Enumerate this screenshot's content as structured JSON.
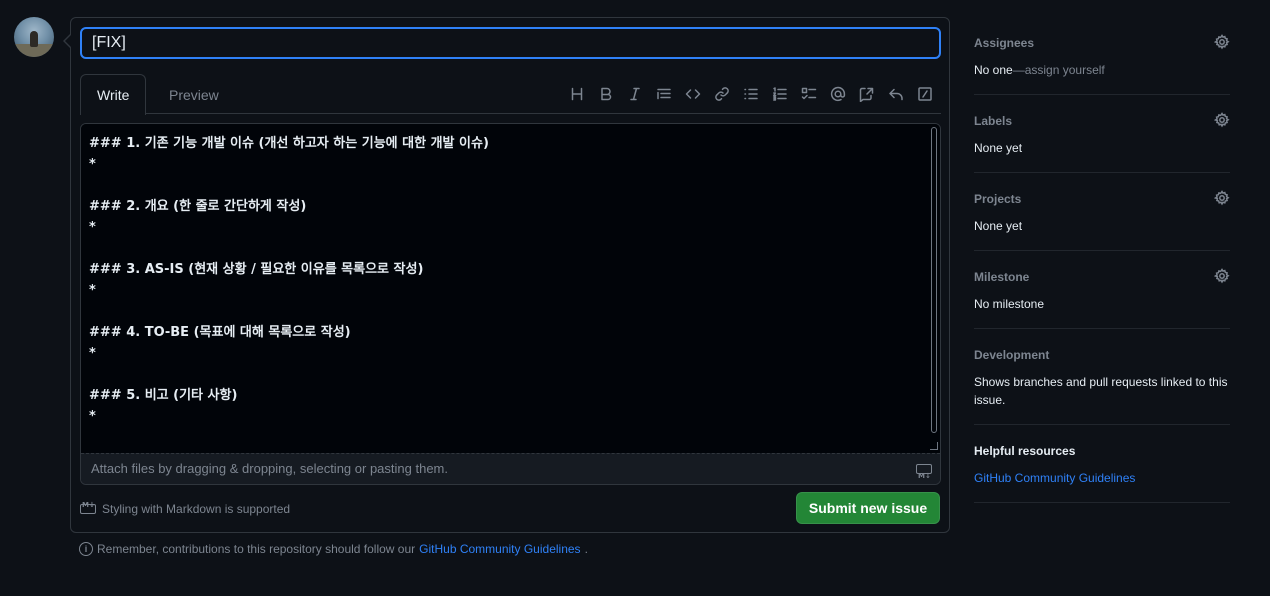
{
  "title_input": {
    "value": "[FIX]"
  },
  "tabs": {
    "write": "Write",
    "preview": "Preview"
  },
  "toolbar": [
    "heading-icon",
    "bold-icon",
    "italic-icon",
    "quote-icon",
    "code-icon",
    "link-icon",
    "unordered-list-icon",
    "ordered-list-icon",
    "task-list-icon",
    "mention-icon",
    "cross-reference-icon",
    "saved-reply-icon",
    "slash-command-icon"
  ],
  "body_text": "### 1. 기존 기능 개발 이슈 (개선 하고자 하는 기능에 대한 개발 이슈)\n*\n\n### 2. 개요 (한 줄로 간단하게 작성)\n*\n\n### 3. AS-IS (현재 상황 / 필요한 이유를 목록으로 작성)\n*\n\n### 4. TO-BE (목표에 대해 목록으로 작성)\n*\n\n### 5. 비고 (기타 사항)\n*",
  "attach_text": "Attach files by dragging & dropping, selecting or pasting them.",
  "markdown_note": "Styling with Markdown is supported",
  "submit_label": "Submit new issue",
  "notice": {
    "prefix": "Remember, contributions to this repository should follow our ",
    "link": "GitHub Community Guidelines",
    "suffix": "."
  },
  "sidebar": {
    "assignees": {
      "heading": "Assignees",
      "value": "No one",
      "dash": "—",
      "action": "assign yourself"
    },
    "labels": {
      "heading": "Labels",
      "value": "None yet"
    },
    "projects": {
      "heading": "Projects",
      "value": "None yet"
    },
    "milestone": {
      "heading": "Milestone",
      "value": "No milestone"
    },
    "development": {
      "heading": "Development",
      "value": "Shows branches and pull requests linked to this issue."
    },
    "helpful": {
      "heading": "Helpful resources",
      "link": "GitHub Community Guidelines"
    }
  },
  "colors": {
    "accent": "#2f81f7",
    "submit": "#238636",
    "background": "#0d1117"
  }
}
